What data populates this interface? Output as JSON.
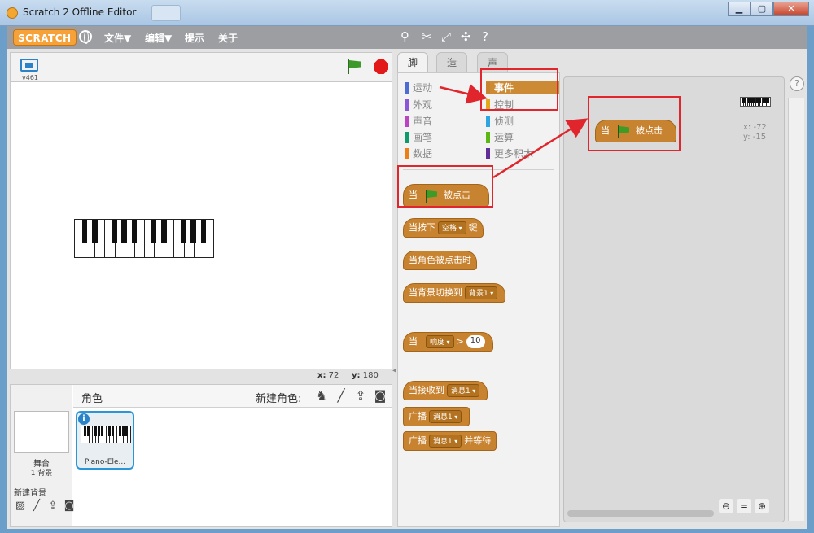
{
  "window": {
    "title": "Scratch 2 Offline Editor",
    "btn_min": "▁",
    "btn_max": "▢",
    "btn_close": "✕"
  },
  "menubar": {
    "logo": "SCRATCH",
    "file": "文件▼",
    "edit": "编辑▼",
    "tips": "提示",
    "about": "关于"
  },
  "stage": {
    "version": "v461",
    "mouse_x_label": "x:",
    "mouse_x": "72",
    "mouse_y_label": "y:",
    "mouse_y": "180"
  },
  "sprites": {
    "header": "角色",
    "new_sprite": "新建角色:",
    "stage_label": "舞台",
    "backdrop_count": "1 背景",
    "new_backdrop": "新建背景",
    "sprite_name": "Piano-Ele..."
  },
  "tabs": {
    "scripts": "脚本",
    "costumes": "造型",
    "sounds": "声音"
  },
  "categories": {
    "motion": "运动",
    "looks": "外观",
    "sound": "声音",
    "pen": "画笔",
    "data": "数据",
    "events": "事件",
    "control": "控制",
    "sensing": "侦测",
    "operators": "运算",
    "more": "更多积木"
  },
  "blocks": {
    "flag_when": "当",
    "flag_clicked": "被点击",
    "key_prefix": "当按下",
    "key_value": "空格",
    "key_suffix": "键",
    "sprite_clicked": "当角色被点击时",
    "backdrop_prefix": "当背景切换到",
    "backdrop_value": "背景1",
    "loud_when": "当",
    "loud_value": "响度",
    "loud_op": ">",
    "loud_num": "10",
    "receive_prefix": "当接收到",
    "receive_value": "消息1",
    "broadcast": "广播",
    "broadcast_value": "消息1",
    "broadcast_wait_value": "消息1",
    "broadcast_wait_suffix": "并等待"
  },
  "script_area": {
    "block_when": "当",
    "block_clicked": "被点击",
    "sprite_x": "x: -72",
    "sprite_y": "y: -15"
  },
  "colors": {
    "events": "#c88330",
    "annotation": "#e0262c",
    "menubar": "#9c9ea2",
    "motion": "#4a6cd4",
    "looks": "#8a55d7",
    "sound": "#bb42c3",
    "pen": "#0e9a6c",
    "data": "#ee7d16",
    "control": "#e1a91a",
    "sensing": "#2ca5e2",
    "operators": "#5cb712",
    "more": "#632d99"
  }
}
